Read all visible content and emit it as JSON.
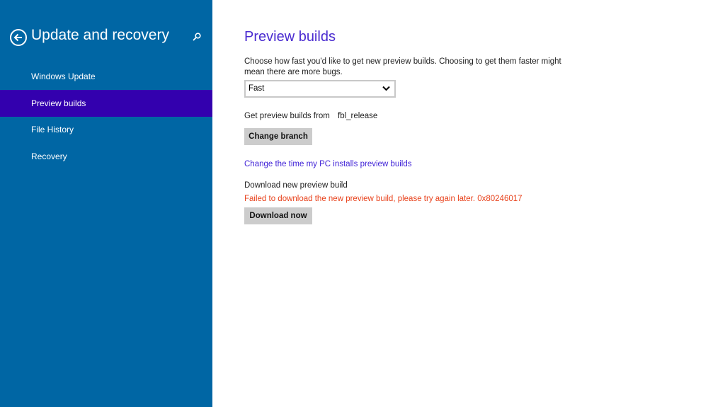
{
  "sidebar": {
    "title": "Update and recovery",
    "items": [
      {
        "label": "Windows Update",
        "selected": false
      },
      {
        "label": "Preview builds",
        "selected": true
      },
      {
        "label": "File History",
        "selected": false
      },
      {
        "label": "Recovery",
        "selected": false
      }
    ]
  },
  "main": {
    "title": "Preview builds",
    "description": "Choose how fast you'd like to get new preview builds. Choosing to get them faster might mean there are more bugs.",
    "speed_select": {
      "value": "Fast"
    },
    "branch_label": "Get preview builds from",
    "branch_value": "fbl_release",
    "change_branch_label": "Change branch",
    "schedule_link": "Change the time my PC installs preview builds",
    "download_label": "Download new preview build",
    "error_message": "Failed to download the new preview build, please try again later. 0x80246017",
    "download_now_label": "Download now"
  },
  "colors": {
    "sidebar": "#0066a4",
    "selected": "#3300ae",
    "accent": "#4a2bd0",
    "error": "#e8421c"
  }
}
